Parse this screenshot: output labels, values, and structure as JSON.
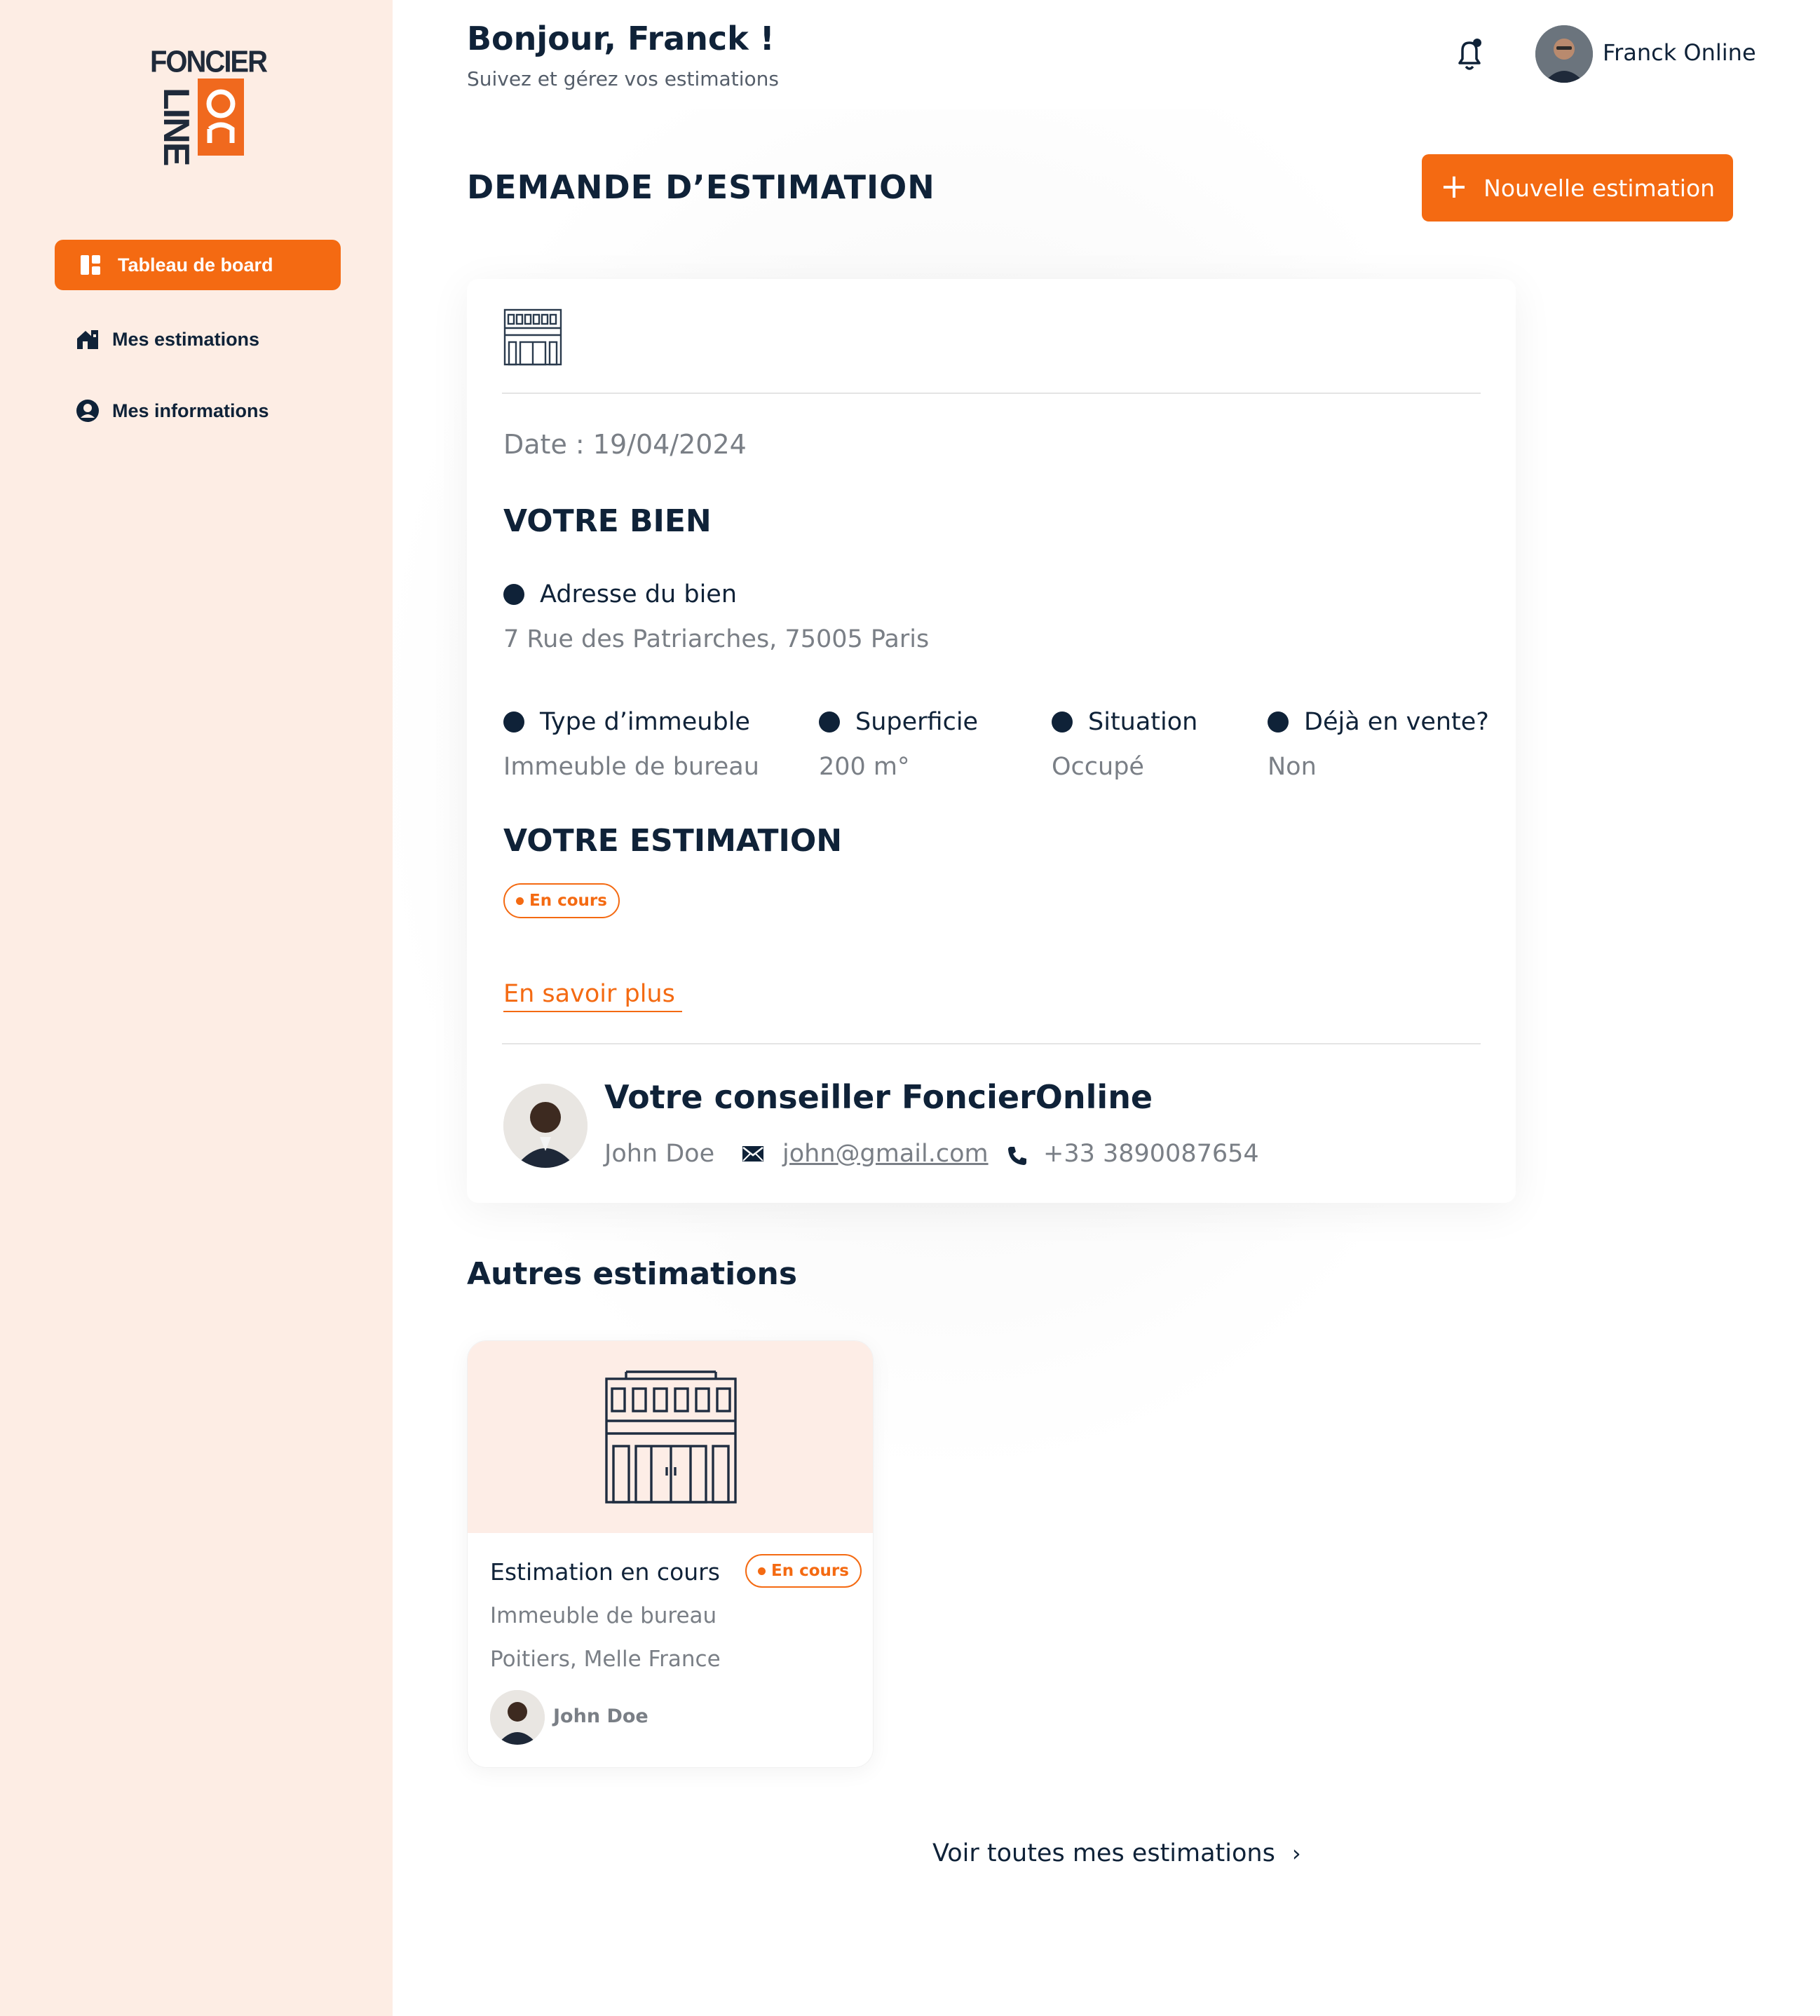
{
  "brand": {
    "top": "FONCIER",
    "line": "LINE",
    "on": "On"
  },
  "sidebar": {
    "items": [
      {
        "label": "Tableau de board",
        "icon": "dashboard-icon",
        "active": true
      },
      {
        "label": "Mes estimations",
        "icon": "house-icon",
        "active": false
      },
      {
        "label": "Mes informations",
        "icon": "user-circle-icon",
        "active": false
      }
    ]
  },
  "header": {
    "greeting": "Bonjour, Franck !",
    "subtitle": "Suivez et gérez vos estimations",
    "user_name": "Franck Online"
  },
  "main": {
    "title": "DEMANDE D’ESTIMATION",
    "new_button": "Nouvelle estimation"
  },
  "estimation": {
    "date": "Date : 19/04/2024",
    "bien_heading": "VOTRE BIEN",
    "address_label": "Adresse du bien",
    "address_value": "7 Rue des Patriarches, 75005 Paris",
    "fields": [
      {
        "label": "Type d’immeuble",
        "value": "Immeuble de bureau"
      },
      {
        "label": "Superficie",
        "value": "200 m°"
      },
      {
        "label": "Situation",
        "value": "Occupé"
      },
      {
        "label": "Déjà en vente?",
        "value": "Non"
      }
    ],
    "estimation_heading": "VOTRE ESTIMATION",
    "status": "En cours",
    "learn_more": "En savoir plus",
    "advisor": {
      "title": "Votre conseiller FoncierOnline",
      "name": "John Doe",
      "email": "john@gmail.com",
      "phone": "+33 3890087654"
    }
  },
  "others": {
    "heading": "Autres estimations",
    "items": [
      {
        "title": "Estimation en cours",
        "status": "En cours",
        "type": "Immeuble de bureau",
        "location": "Poitiers, Melle France",
        "advisor": "John Doe"
      }
    ],
    "see_all": "Voir toutes mes estimations"
  },
  "colors": {
    "accent": "#f46a12",
    "navy": "#0f2238",
    "sidebar_bg": "#fdede4",
    "muted": "#7a7f86"
  }
}
